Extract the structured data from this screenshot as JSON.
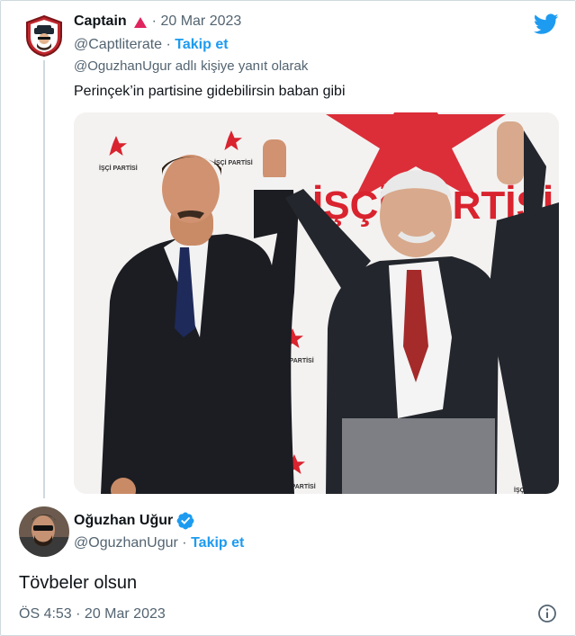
{
  "colors": {
    "accent": "#1d9bf0",
    "text": "#0f1419",
    "muted": "#536471",
    "party_red": "#d9232e"
  },
  "reply_tweet": {
    "name": "Captain",
    "date": " · 20 Mar 2023",
    "handle": "@Captliterate",
    "separator": " · ",
    "follow_label": "Takip et",
    "replying_to": "@OguzhanUgur adlı kişiye yanıt olarak",
    "text": "Perinçek’in partisine gidebilirsin baban gibi",
    "avatar_icon": "captain-avatar",
    "badge_icon": "red-triangle-icon"
  },
  "photo": {
    "banner_text": "İŞÇİ PARTİSİ",
    "small_logo_text": "İŞÇİ PARTİSİ",
    "description_icon": "photo"
  },
  "main_tweet": {
    "name": "Oğuzhan Uğur",
    "handle": "@OguzhanUgur",
    "separator": " · ",
    "follow_label": "Takip et",
    "text": "Tövbeler olsun",
    "timestamp": "ÖS 4:53 · 20 Mar 2023",
    "verified_icon": "verified-badge-icon",
    "info_icon": "info-icon"
  },
  "brand_icon": "twitter-bird-icon"
}
